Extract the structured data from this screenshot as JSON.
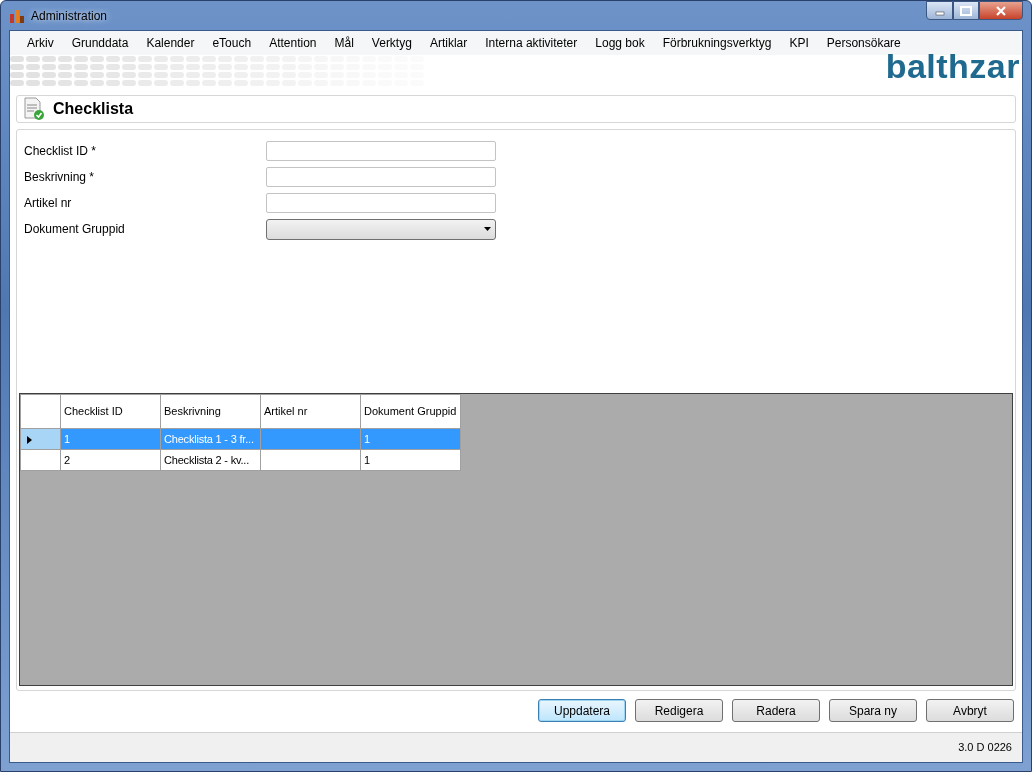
{
  "window": {
    "title": "Administration"
  },
  "menu": [
    "Arkiv",
    "Grunddata",
    "Kalender",
    "eTouch",
    "Attention",
    "Mål",
    "Verktyg",
    "Artiklar",
    "Interna aktiviteter",
    "Logg bok",
    "Förbrukningsverktyg",
    "KPI",
    "Personsökare"
  ],
  "logo": "balthzar",
  "page_title": "Checklista",
  "form": {
    "fields": [
      {
        "label": "Checklist ID *",
        "kind": "text"
      },
      {
        "label": "Beskrivning *",
        "kind": "text"
      },
      {
        "label": "Artikel nr",
        "kind": "text"
      },
      {
        "label": "Dokument Gruppid",
        "kind": "select"
      }
    ]
  },
  "grid": {
    "columns": [
      "Checklist ID",
      "Beskrivning",
      "Artikel nr",
      "Dokument Gruppid"
    ],
    "rows": [
      {
        "cells": [
          "1",
          "Checklista 1 - 3 fr...",
          null,
          "1"
        ],
        "selected": true
      },
      {
        "cells": [
          "2",
          "Checklista 2 - kv...",
          null,
          "1"
        ],
        "selected": false
      }
    ]
  },
  "buttons": [
    {
      "label": "Uppdatera",
      "focused": true
    },
    {
      "label": "Redigera",
      "focused": false
    },
    {
      "label": "Radera",
      "focused": false
    },
    {
      "label": "Spara ny",
      "focused": false
    },
    {
      "label": "Avbryt",
      "focused": false
    }
  ],
  "status_bar": {
    "version": "3.0 D 0226"
  }
}
